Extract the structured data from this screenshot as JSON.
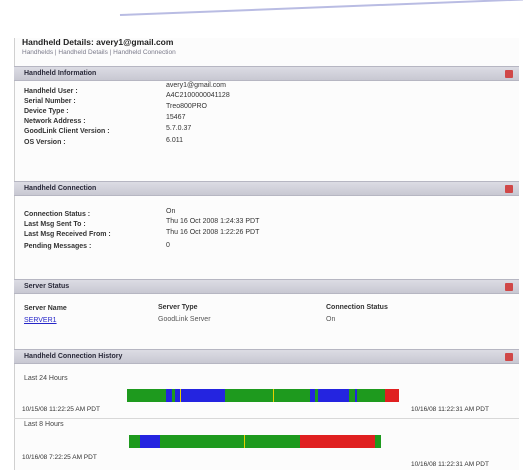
{
  "header": {
    "title": "Handheld Details: avery1@gmail.com",
    "subtitle": "Handhelds | Handheld Details | Handheld Connection"
  },
  "handheld_info": {
    "heading": "Handheld Information",
    "fields": [
      {
        "label": "Handheld User :",
        "value": "avery1@gmail.com"
      },
      {
        "label": "Serial Number :",
        "value": "A4C2100000041128"
      },
      {
        "label": "Device Type :",
        "value": "Treo800PRO"
      },
      {
        "label": "Network Address :",
        "value": "15467"
      },
      {
        "label": "GoodLink Client Version :",
        "value": "5.7.0.37"
      },
      {
        "label": "OS Version :",
        "value": "6.011"
      }
    ]
  },
  "connection_info": {
    "heading": "Handheld Connection",
    "fields": [
      {
        "label": "Connection Status :",
        "value": "On"
      },
      {
        "label": "Last Msg Sent To :",
        "value": "Thu 16 Oct 2008  1:24:33 PDT"
      },
      {
        "label": "Last Msg Received From :",
        "value": "Thu 16 Oct 2008  1:22:26 PDT"
      },
      {
        "label": "Pending Messages :",
        "value": "0"
      }
    ]
  },
  "server_status": {
    "heading": "Server Status",
    "columns": [
      "Server Name",
      "Server Type",
      "Connection Status"
    ],
    "row": {
      "name": "SERVER1",
      "type": "GoodLink Server",
      "status": "On"
    }
  },
  "history": {
    "heading": "Handheld Connection History",
    "graphs": [
      {
        "label": "Last 24 Hours",
        "start": "10/15/08 11:22:25 AM PDT",
        "end": "10/16/08 11:22:31 AM PDT",
        "segments": [
          {
            "color": "#1e9a1e",
            "fraction": 0.14
          },
          {
            "color": "#2424e0",
            "fraction": 0.02
          },
          {
            "color": "#1e9a1e",
            "fraction": 0.01
          },
          {
            "color": "#2424e0",
            "fraction": 0.18
          },
          {
            "color": "#1e9a1e",
            "fraction": 0.3
          },
          {
            "color": "#2424e0",
            "fraction": 0.02
          },
          {
            "color": "#1e9a1e",
            "fraction": 0.01
          },
          {
            "color": "#2424e0",
            "fraction": 0.11
          },
          {
            "color": "#1e9a1e",
            "fraction": 0.02
          },
          {
            "color": "#2424e0",
            "fraction": 0.01
          },
          {
            "color": "#1e9a1e",
            "fraction": 0.1
          },
          {
            "color": "#e02020",
            "fraction": 0.05
          }
        ],
        "ticks": [
          0.19,
          0.52
        ]
      },
      {
        "label": "Last 8 Hours",
        "start": "10/16/08 7:22:25 AM PDT",
        "end": "10/16/08 11:22:31 AM PDT",
        "segments": [
          {
            "color": "#1e9a1e",
            "fraction": 0.04
          },
          {
            "color": "#2424e0",
            "fraction": 0.07
          },
          {
            "color": "#1e9a1e",
            "fraction": 0.3
          },
          {
            "color": "#1e9a1e",
            "fraction": 0.2
          },
          {
            "color": "#e02020",
            "fraction": 0.27
          },
          {
            "color": "#1e9a1e",
            "fraction": 0.02
          }
        ],
        "ticks": [
          0.41
        ]
      }
    ]
  },
  "colors": {
    "online": "#1e9a1e",
    "busy": "#2424e0",
    "offline": "#e02020",
    "marker": "#e8d000"
  }
}
